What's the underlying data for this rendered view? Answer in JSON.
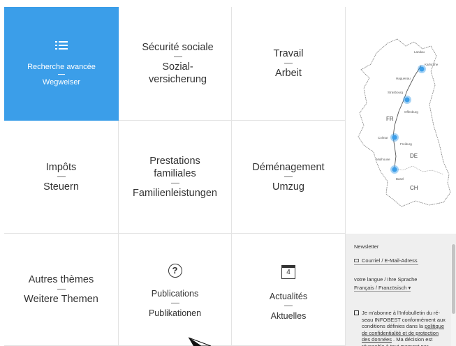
{
  "tiles": {
    "search": {
      "fr": "Recherche avancée",
      "de": "Wegweiser",
      "icon": "list-icon"
    },
    "social": {
      "fr": "Sécurité sociale",
      "de": "Sozial-\nversicherung"
    },
    "work": {
      "fr": "Travail",
      "de": "Arbeit"
    },
    "tax": {
      "fr": "Impôts",
      "de": "Steuern"
    },
    "family": {
      "fr": "Prestations familiales",
      "de": "Familienleistungen"
    },
    "moving": {
      "fr": "Déménagement",
      "de": "Umzug"
    },
    "other": {
      "fr": "Autres thèmes",
      "de": "Weitere Themen"
    },
    "publications": {
      "fr": "Publications",
      "de": "Publikationen",
      "icon": "question-icon",
      "icon_glyph": "?"
    },
    "news": {
      "fr": "Actualités",
      "de": "Aktuelles",
      "icon": "calendar-icon",
      "icon_glyph": "4"
    }
  },
  "map": {
    "cities": [
      "Landau",
      "Karlsruhe",
      "Haguenau",
      "Strasbourg",
      "Offenburg",
      "Colmar",
      "Freiburg",
      "Mulhouse",
      "Basel"
    ],
    "regions": [
      "FR",
      "DE",
      "CH"
    ],
    "accent": "#3b9ee9"
  },
  "newsletter": {
    "title": "Newsletter",
    "email_placeholder": "Courriel / E-Mail-Adress",
    "lang_label": "votre langue / Ihre Sprache",
    "lang_value": "Français / Französisch",
    "consent_a": "Je m'abonne à l'Infobulletin du ré-seau INFOBEST conformément aux conditions définies dans la ",
    "consent_link": "politique de confidentialité et de protection des données",
    "consent_b": " . Ma décision est révocable à tout moment par courriel."
  }
}
